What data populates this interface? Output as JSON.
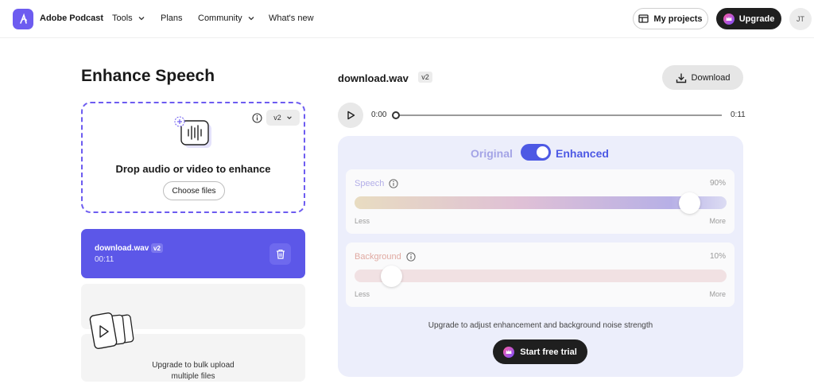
{
  "header": {
    "brand": "Adobe Podcast",
    "nav": [
      {
        "label": "Tools"
      },
      {
        "label": "Plans"
      },
      {
        "label": "Community"
      },
      {
        "label": "What's new"
      }
    ],
    "my_projects": "My projects",
    "upgrade": "Upgrade",
    "avatar_initials": "JT"
  },
  "left": {
    "title": "Enhance Speech",
    "dropzone": {
      "title": "Drop audio or video to enhance",
      "choose_files": "Choose files",
      "version": "v2"
    },
    "file": {
      "name": "download.wav",
      "badge": "v2",
      "duration": "00:11"
    },
    "bulk": {
      "line1": "Upgrade to bulk upload",
      "line2": "multiple files"
    }
  },
  "right": {
    "filename": "download.wav",
    "badge": "v2",
    "download": "Download",
    "player": {
      "current": "0:00",
      "end": "0:11",
      "progress": 0
    },
    "toggle": {
      "original": "Original",
      "enhanced": "Enhanced",
      "state": "enhanced"
    },
    "speech": {
      "label": "Speech",
      "value_text": "90%",
      "value": 0.9,
      "less": "Less",
      "more": "More"
    },
    "background": {
      "label": "Background",
      "value_text": "10%",
      "value": 0.1,
      "less": "Less",
      "more": "More"
    },
    "note": "Upgrade to adjust enhancement and background noise strength",
    "trial": "Start free trial"
  },
  "colors": {
    "accent": "#5c57e8",
    "toggle_on": "#4d59e4",
    "panel_bg": "#eceefb",
    "dark_button": "#1f1f1f"
  },
  "icons": [
    "adobe-podcast-logo-icon",
    "chevron-down-icon",
    "folder-icon",
    "crown-icon",
    "info-icon",
    "add-audio-icon",
    "trash-icon",
    "video-files-icon",
    "download-icon",
    "play-icon"
  ]
}
